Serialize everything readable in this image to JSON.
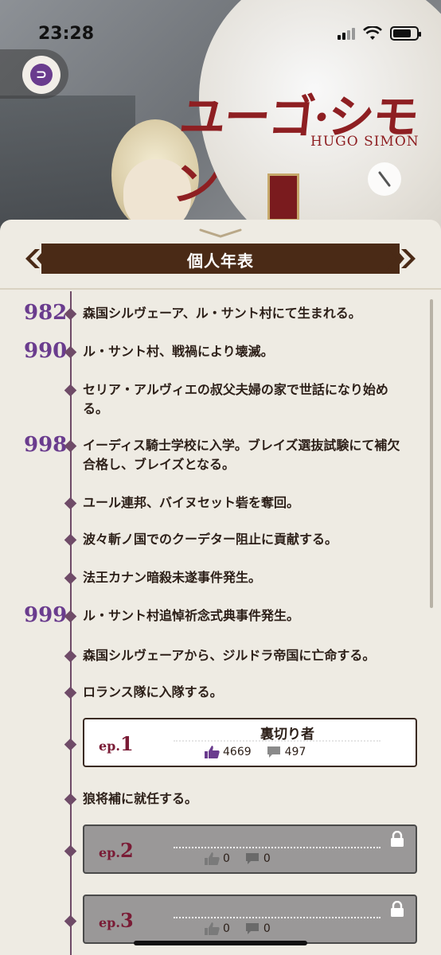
{
  "status": {
    "time": "23:28"
  },
  "hero": {
    "title": "ユーゴ·シモン",
    "subtitle": "HUGO SIMON"
  },
  "section": {
    "title": "個人年表"
  },
  "timeline": [
    {
      "year": "982",
      "text": "森国シルヴェーア、ル・サント村にて生まれる。"
    },
    {
      "year": "990",
      "text": "ル・サント村、戦禍により壊滅。"
    },
    {
      "year": "",
      "text": "セリア・アルヴィエの叔父夫婦の家で世話になり始める。"
    },
    {
      "year": "998",
      "text": "イーディス騎士学校に入学。ブレイズ選抜試験にて補欠合格し、ブレイズとなる。"
    },
    {
      "year": "",
      "text": "ユール連邦、バイヌセット砦を奪回。"
    },
    {
      "year": "",
      "text": "波々斬ノ国でのクーデター阻止に貢献する。"
    },
    {
      "year": "",
      "text": "法王カナン暗殺未遂事件発生。"
    },
    {
      "year": "999",
      "text": "ル・サント村追悼祈念式典事件発生。"
    },
    {
      "year": "",
      "text": "森国シルヴェーアから、ジルドラ帝国に亡命する。"
    },
    {
      "year": "",
      "text": "ロランス隊に入隊する。"
    }
  ],
  "episodes": [
    {
      "prefix": "ep.",
      "number": "1",
      "title": "裏切り者",
      "likes": "4669",
      "comments": "497",
      "locked": false
    },
    {
      "prefix": "ep.",
      "number": "2",
      "title": "",
      "likes": "0",
      "comments": "0",
      "locked": true
    },
    {
      "prefix": "ep.",
      "number": "3",
      "title": "",
      "likes": "0",
      "comments": "0",
      "locked": true
    }
  ],
  "after_ep1": {
    "text": "狼将補に就任する。"
  },
  "colors": {
    "accent": "#6a3c8e",
    "band": "#4a2a16",
    "ep_label": "#7a1b35"
  }
}
